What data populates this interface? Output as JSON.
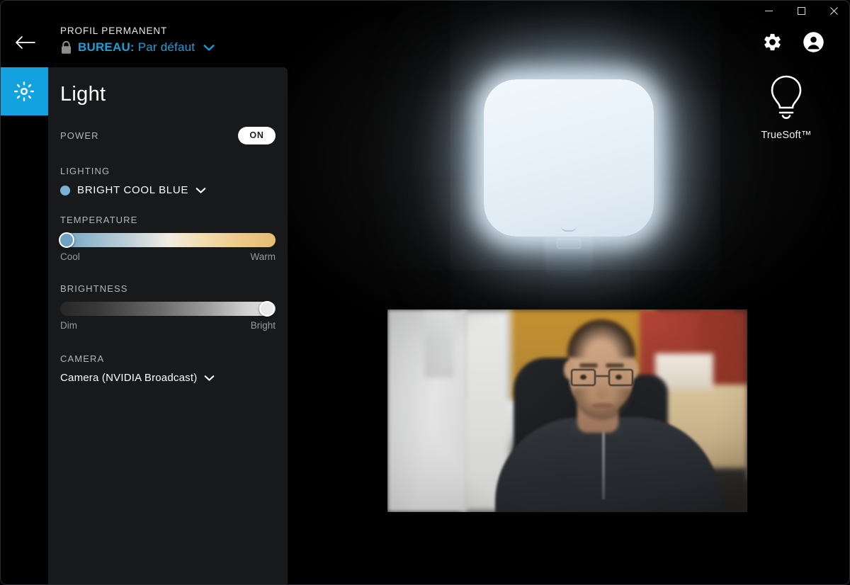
{
  "window": {
    "minimize_label": "Minimize",
    "maximize_label": "Maximize",
    "close_label": "Close"
  },
  "header": {
    "back_label": "Back",
    "profile_kicker": "PROFIL PERMANENT",
    "profile_lock": "lock-icon",
    "profile_name_prefix": "BUREAU:",
    "profile_name_value": "Par défaut",
    "settings_label": "Settings",
    "account_label": "Account"
  },
  "branding": {
    "bulb_icon": "lightbulb-icon",
    "label": "TrueSoft™"
  },
  "rail": {
    "items": [
      {
        "icon": "brightness-sun-icon",
        "label": "Light",
        "active": true
      }
    ],
    "active_color": "#12a2e0"
  },
  "panel": {
    "title": "Light",
    "power": {
      "label": "POWER",
      "state": "ON"
    },
    "lighting": {
      "label": "LIGHTING",
      "preset": "BRIGHT COOL BLUE",
      "preset_color": "#7ab4d4"
    },
    "temperature": {
      "label": "TEMPERATURE",
      "min_label": "Cool",
      "max_label": "Warm",
      "value_percent": 3
    },
    "brightness": {
      "label": "BRIGHTNESS",
      "min_label": "Dim",
      "max_label": "Bright",
      "value_percent": 96
    },
    "camera": {
      "label": "CAMERA",
      "selected": "Camera (NVIDIA Broadcast)"
    }
  },
  "stage": {
    "lamp_name": "light-panel-preview",
    "webcam_name": "camera-preview"
  }
}
